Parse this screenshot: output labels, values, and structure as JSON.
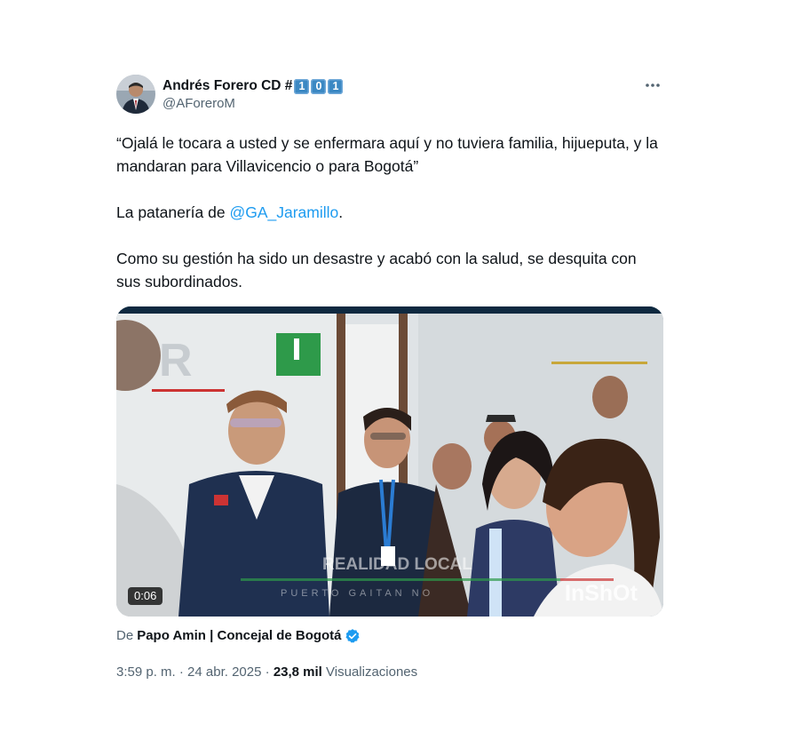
{
  "author": {
    "display_name": "Andrés Forero CD #",
    "keycaps": [
      "1",
      "0",
      "1"
    ],
    "handle": "@AForeroM"
  },
  "more_icon": "more-horizontal-icon",
  "body": {
    "quote": "“Ojalá le tocara a usted y se enfermara aquí y no tuviera familia, hijueputa, y la mandaran para Villavicencio o para Bogotá”",
    "line2_prefix": "La patanería de ",
    "mention": "@GA_Jaramillo",
    "line2_suffix": ".",
    "paragraph3": "Como su gestión ha sido un desastre y acabó con la salud, se desquita con sus subordinados."
  },
  "media": {
    "type": "video",
    "duration": "0:06",
    "overlay_watermark": "REALIDAD LOCAL",
    "overlay_ticker": "PUERTO GAITAN NO",
    "app_watermark": "InShOt",
    "logo_letter": "R"
  },
  "source": {
    "prefix": "De",
    "name": "Papo Amin | Concejal de Bogotá",
    "verified_icon": "verified-badge-icon"
  },
  "meta": {
    "time": "3:59 p. m.",
    "separator": "·",
    "date": "24 abr. 2025",
    "views_count": "23,8 mil",
    "views_label": "Visualizaciones"
  },
  "colors": {
    "link": "#1d9bf0",
    "secondary_text": "#536471",
    "primary_text": "#0f1419",
    "keycap": "#3b88c3",
    "verified": "#1d9bf0"
  }
}
